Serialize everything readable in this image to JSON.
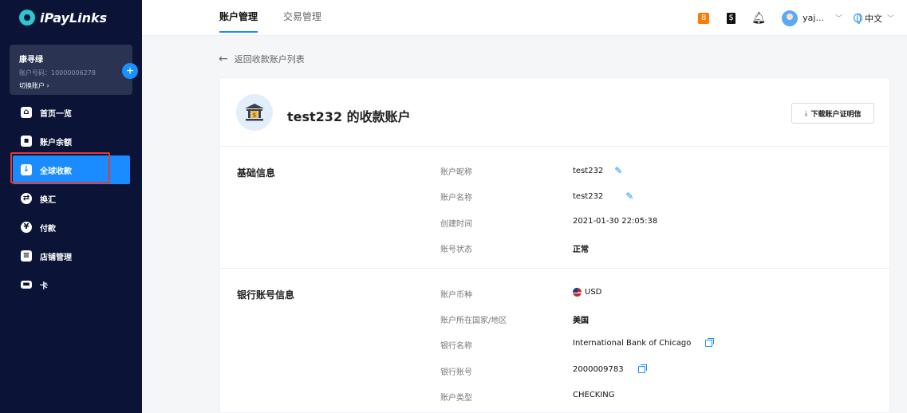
{
  "app": {
    "logo_text": "iPayLinks"
  },
  "account": {
    "name": "康寻绿",
    "number": "账户号码：10000006278",
    "switch_label": "切换账户 ›",
    "add_label": "+"
  },
  "sidebar": {
    "items": [
      {
        "label": "首页一览",
        "icon": "home-icon"
      },
      {
        "label": "账户余额",
        "icon": "wallet-icon"
      },
      {
        "label": "全球收款",
        "icon": "receive-icon"
      },
      {
        "label": "换汇",
        "icon": "exchange-icon"
      },
      {
        "label": "付款",
        "icon": "yen-icon"
      },
      {
        "label": "店铺管理",
        "icon": "store-icon"
      },
      {
        "label": "卡",
        "icon": "card-icon"
      }
    ],
    "active_index": 2
  },
  "header": {
    "tabs": [
      {
        "label": "账户管理"
      },
      {
        "label": "交易管理"
      }
    ],
    "user_name": "yaj...",
    "language": "中文"
  },
  "back_link": "返回收款账户列表",
  "card": {
    "title": "test232 的收款账户",
    "download_label": "下载账户证明信",
    "basic": {
      "title": "基础信息",
      "rows": [
        {
          "label": "账户昵称",
          "value": "test232"
        },
        {
          "label": "账户名称",
          "value": "test232"
        },
        {
          "label": "创建时间",
          "value": "2021-01-30 22:05:38"
        },
        {
          "label": "账号状态",
          "value": "正常"
        }
      ]
    },
    "bank": {
      "title": "银行账号信息",
      "rows": [
        {
          "label": "账户币种",
          "value": "USD"
        },
        {
          "label": "账户所在国家/地区",
          "value": "美国"
        },
        {
          "label": "银行名称",
          "value": "International Bank of Chicago"
        },
        {
          "label": "银行账号",
          "value": "2000009783"
        },
        {
          "label": "账户类型",
          "value": "CHECKING"
        }
      ]
    }
  },
  "colors": {
    "sidebar_bg": "#0b1437",
    "accent": "#1a8cff",
    "highlight": "#e53935"
  }
}
